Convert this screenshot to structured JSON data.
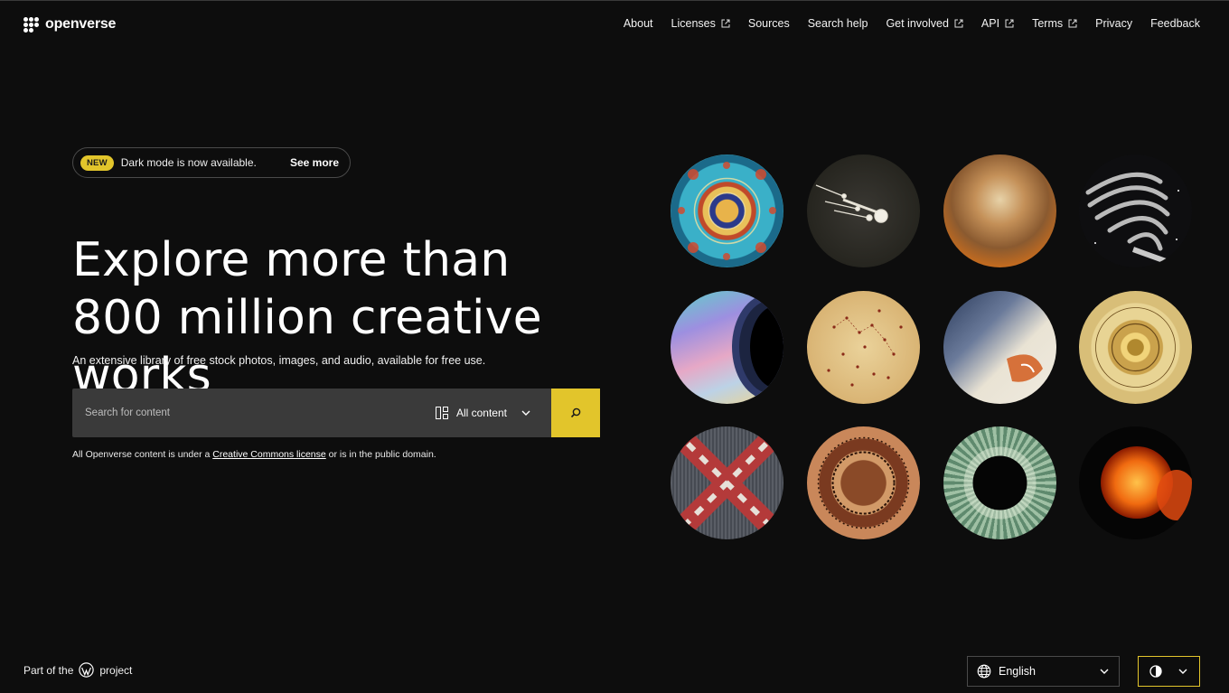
{
  "header": {
    "logo_text": "openverse",
    "nav": [
      {
        "label": "About",
        "external": false
      },
      {
        "label": "Licenses",
        "external": true
      },
      {
        "label": "Sources",
        "external": false
      },
      {
        "label": "Search help",
        "external": false
      },
      {
        "label": "Get involved",
        "external": true
      },
      {
        "label": "API",
        "external": true
      },
      {
        "label": "Terms",
        "external": true
      },
      {
        "label": "Privacy",
        "external": false
      },
      {
        "label": "Feedback",
        "external": false
      }
    ]
  },
  "banner": {
    "badge": "NEW",
    "text": "Dark mode is now available.",
    "link": "See more"
  },
  "hero": {
    "title": "Explore more than 800 million creative works",
    "subtitle": "An extensive library of free stock photos, images, and audio, available for free use."
  },
  "search": {
    "placeholder": "Search for content",
    "content_type": "All content"
  },
  "license_note": {
    "prefix": "All Openverse content is under a ",
    "link": "Creative Commons license",
    "suffix": " or is in the public domain."
  },
  "gallery": {
    "items": [
      "kaleidoscope-tile",
      "comets",
      "nebula",
      "comet-tail",
      "ringed-planet",
      "star-chart",
      "celestial-figure",
      "astronomical-dial",
      "woven-x-pattern",
      "engraved-plate",
      "solar-eclipse",
      "solar-flare"
    ]
  },
  "footer": {
    "part_of_prefix": "Part of the",
    "part_of_suffix": "project",
    "language": "English"
  },
  "colors": {
    "background": "#0d0d0d",
    "accent": "#e2c52b",
    "surface": "#3a3a3a"
  }
}
